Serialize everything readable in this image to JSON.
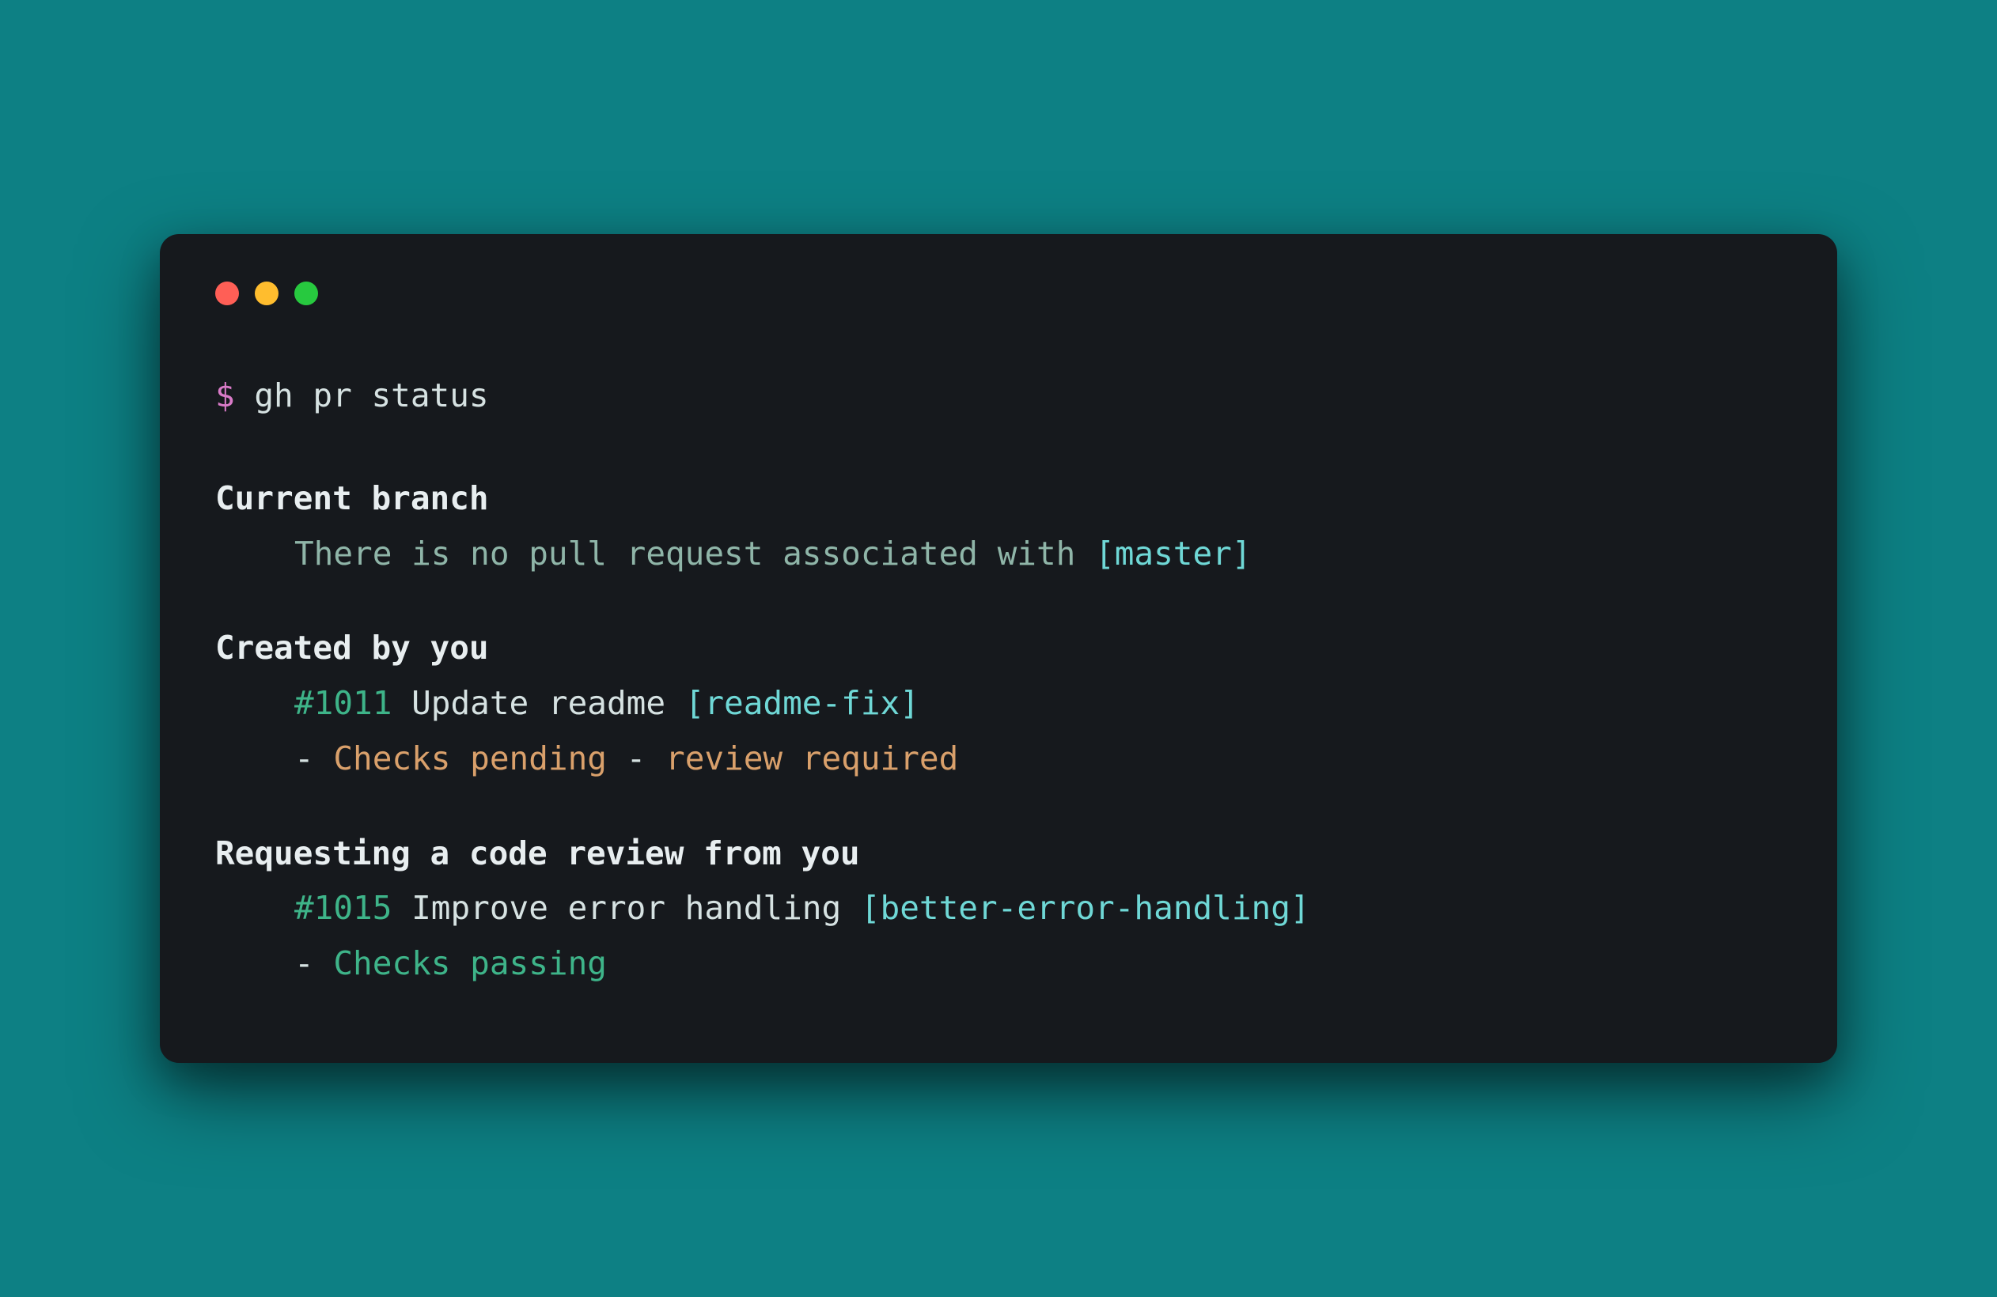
{
  "prompt": {
    "symbol": "$",
    "command": "gh pr status"
  },
  "sections": {
    "current_branch": {
      "header": "Current branch",
      "message": "There is no pull request associated with ",
      "branch": "[master]"
    },
    "created_by_you": {
      "header": "Created by you",
      "pr_number": "#1011",
      "pr_title": "Update readme ",
      "pr_branch": "[readme-fix]",
      "status_dash1": "- ",
      "status1": "Checks pending",
      "status_dash2": " - ",
      "status2": "review required"
    },
    "requesting_review": {
      "header": "Requesting a code review from you",
      "pr_number": "#1015",
      "pr_title": "Improve error handling ",
      "pr_branch": "[better-error-handling]",
      "status_dash": "- ",
      "status": "Checks passing"
    }
  }
}
